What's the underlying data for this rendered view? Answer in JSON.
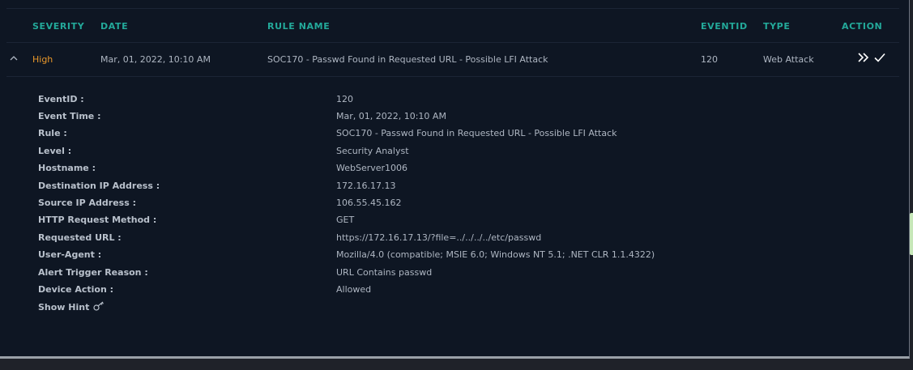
{
  "table": {
    "headers": {
      "severity": "SEVERITY",
      "date": "DATE",
      "rule_name": "RULE NAME",
      "eventid": "EVENTID",
      "type": "TYPE",
      "action": "ACTION"
    },
    "row": {
      "severity": "High",
      "date": "Mar, 01, 2022, 10:10 AM",
      "rule_name": "SOC170 - Passwd Found in Requested URL - Possible LFI Attack",
      "eventid": "120",
      "type": "Web Attack"
    }
  },
  "details": [
    {
      "label": "EventID :",
      "value": "120"
    },
    {
      "label": "Event Time :",
      "value": "Mar, 01, 2022, 10:10 AM"
    },
    {
      "label": "Rule :",
      "value": "SOC170 - Passwd Found in Requested URL - Possible LFI Attack"
    },
    {
      "label": "Level :",
      "value": "Security Analyst"
    },
    {
      "label": "Hostname :",
      "value": "WebServer1006"
    },
    {
      "label": "Destination IP Address :",
      "value": "172.16.17.13"
    },
    {
      "label": "Source IP Address :",
      "value": "106.55.45.162"
    },
    {
      "label": "HTTP Request Method :",
      "value": "GET"
    },
    {
      "label": "Requested URL :",
      "value": "https://172.16.17.13/?file=../../../../etc/passwd"
    },
    {
      "label": "User-Agent :",
      "value": "Mozilla/4.0 (compatible; MSIE 6.0; Windows NT 5.1; .NET CLR 1.1.4322)"
    },
    {
      "label": "Alert Trigger Reason :",
      "value": "URL Contains passwd"
    },
    {
      "label": "Device Action :",
      "value": "Allowed"
    }
  ],
  "hint": {
    "label": "Show Hint"
  },
  "icons": {
    "collapse": "chevron-up-icon",
    "escalate": "double-chevron-right-icon",
    "close": "check-icon",
    "hint": "key-icon"
  },
  "colors": {
    "background": "#0e1623",
    "header": "#23a99a",
    "severity_high": "#e8972a",
    "text": "#aeb6c2"
  }
}
